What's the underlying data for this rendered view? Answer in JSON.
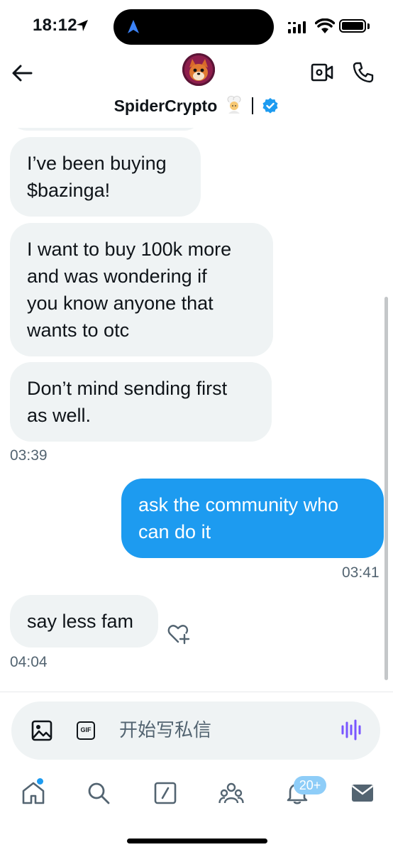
{
  "status_bar": {
    "time": "18:12"
  },
  "header": {
    "contact_name": "SpiderCrypto",
    "name_emoji": "chef",
    "verified": true
  },
  "messages": [
    {
      "direction": "in",
      "lines": [
        "I’ve been buying",
        "$bazinga!"
      ]
    },
    {
      "direction": "in",
      "lines": [
        "I want to buy 100k more",
        "and was wondering if",
        "you know anyone that",
        "wants to otc"
      ]
    },
    {
      "direction": "in",
      "lines": [
        "Don’t mind sending first",
        "as well."
      ],
      "timestamp": "03:39"
    },
    {
      "direction": "out",
      "lines": [
        "ask the community who",
        "can do it"
      ],
      "timestamp": "03:41"
    },
    {
      "direction": "in",
      "lines": [
        "say less fam"
      ],
      "timestamp": "04:04"
    }
  ],
  "composer": {
    "placeholder": "开始写私信"
  },
  "tab_bar": {
    "notifications_badge": "20+"
  },
  "colors": {
    "accent": "#1d9bf0",
    "incoming_bubble": "#eff3f4",
    "text": "#0f1419",
    "muted": "#536471",
    "voice_icon": "#7856ff"
  },
  "icons": [
    "back-arrow-icon",
    "video-camera-icon",
    "phone-icon",
    "verified-badge-icon",
    "add-reaction-icon",
    "image-icon",
    "gif-icon",
    "voice-wave-icon",
    "home-icon",
    "search-icon",
    "grok-icon",
    "communities-icon",
    "bell-icon",
    "mail-icon"
  ]
}
